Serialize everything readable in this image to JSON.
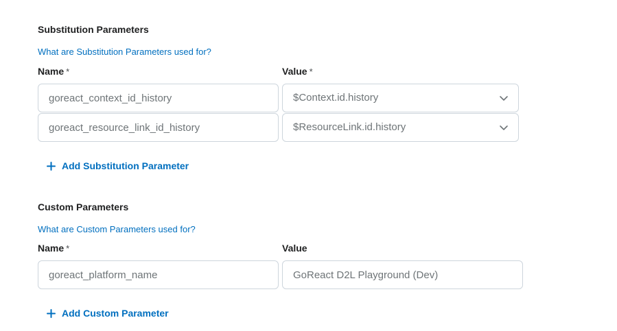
{
  "substitution": {
    "title": "Substitution Parameters",
    "help_link": "What are Substitution Parameters used for?",
    "name_label": "Name",
    "value_label": "Value",
    "required_mark": "*",
    "rows": [
      {
        "name": "goreact_context_id_history",
        "value": "$Context.id.history"
      },
      {
        "name": "goreact_resource_link_id_history",
        "value": "$ResourceLink.id.history"
      }
    ],
    "add_label": "Add Substitution Parameter"
  },
  "custom": {
    "title": "Custom Parameters",
    "help_link": "What are Custom Parameters used for?",
    "name_label": "Name",
    "value_label": "Value",
    "required_mark": "*",
    "rows": [
      {
        "name": "goreact_platform_name",
        "value": "GoReact D2L Playground (Dev)"
      }
    ],
    "add_label": "Add Custom Parameter"
  },
  "icons": {
    "dropdown": "chevron-down-icon",
    "add": "plus-icon"
  },
  "colors": {
    "link": "#006fbf",
    "border": "#cdd5dc",
    "text": "#202122",
    "muted": "#6e7477"
  }
}
